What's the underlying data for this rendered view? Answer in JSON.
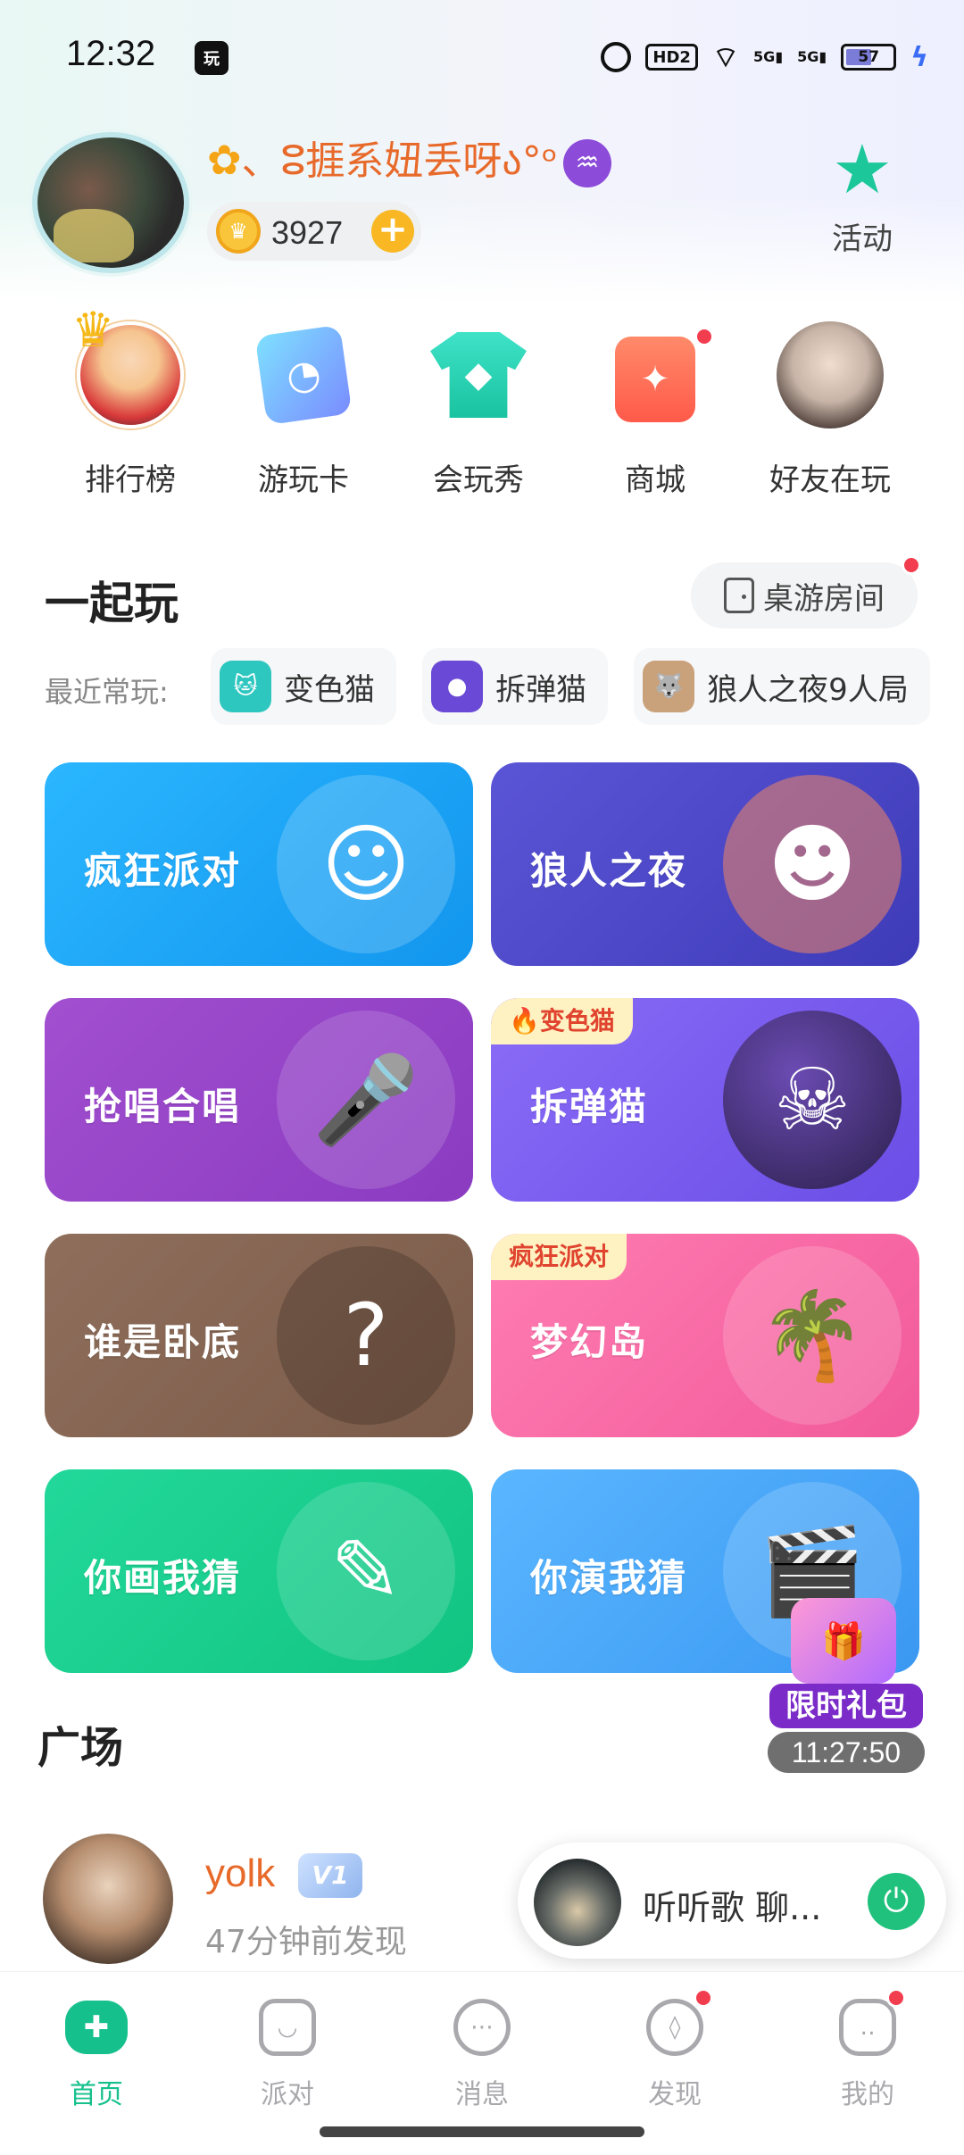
{
  "status_bar": {
    "time": "12:32",
    "app_icon_text": "玩",
    "hd_label": "HD2",
    "sig1": "5G",
    "sig2": "5G",
    "battery": "57"
  },
  "profile": {
    "username": "、ⵓ捱系妞丢呀ა°ᵒ",
    "coins": "3927",
    "activity_label": "活动"
  },
  "quick_entries": [
    {
      "label": "排行榜",
      "icon": "crown-avatar-icon"
    },
    {
      "label": "游玩卡",
      "icon": "card-icon"
    },
    {
      "label": "会玩秀",
      "icon": "shirt-icon"
    },
    {
      "label": "商城",
      "icon": "shopping-bag-icon"
    },
    {
      "label": "好友在玩",
      "icon": "friend-avatar-icon"
    }
  ],
  "play_together": {
    "title": "一起玩",
    "room_button": "桌游房间",
    "recent_label": "最近常玩:",
    "recent_games": [
      "变色猫",
      "拆弹猫",
      "狼人之夜9人局"
    ]
  },
  "games": [
    {
      "name": "疯狂派对",
      "tag": "",
      "color": "#1aa6f5"
    },
    {
      "name": "狼人之夜",
      "tag": "",
      "color": "#4b4bc9"
    },
    {
      "name": "抢唱合唱",
      "tag": "",
      "color": "#9a43c9"
    },
    {
      "name": "拆弹猫",
      "tag": "🔥变色猫",
      "color": "#7a5cf0"
    },
    {
      "name": "谁是卧底",
      "tag": "",
      "color": "#866552"
    },
    {
      "name": "梦幻岛",
      "tag": "疯狂派对",
      "color": "#f56aa6"
    },
    {
      "name": "你画我猜",
      "tag": "",
      "color": "#1bcf8e"
    },
    {
      "name": "你演我猜",
      "tag": "",
      "color": "#3aa3f7"
    }
  ],
  "plaza": {
    "title": "广场",
    "post_user": "yolk",
    "vip": "V1",
    "post_time": "47分钟前发现"
  },
  "gift": {
    "title": "限时礼包",
    "timer": "11:27:50"
  },
  "music": {
    "text": "听听歌 聊..."
  },
  "tabbar": [
    {
      "label": "首页",
      "icon": "gamepad-icon",
      "active": true
    },
    {
      "label": "派对",
      "icon": "party-icon",
      "active": false
    },
    {
      "label": "消息",
      "icon": "message-icon",
      "active": false
    },
    {
      "label": "发现",
      "icon": "compass-icon",
      "active": false
    },
    {
      "label": "我的",
      "icon": "profile-icon",
      "active": false
    }
  ],
  "colors": {
    "brand": "#16c08c",
    "username": "#e86a2b",
    "badge": "#f23d4f"
  }
}
